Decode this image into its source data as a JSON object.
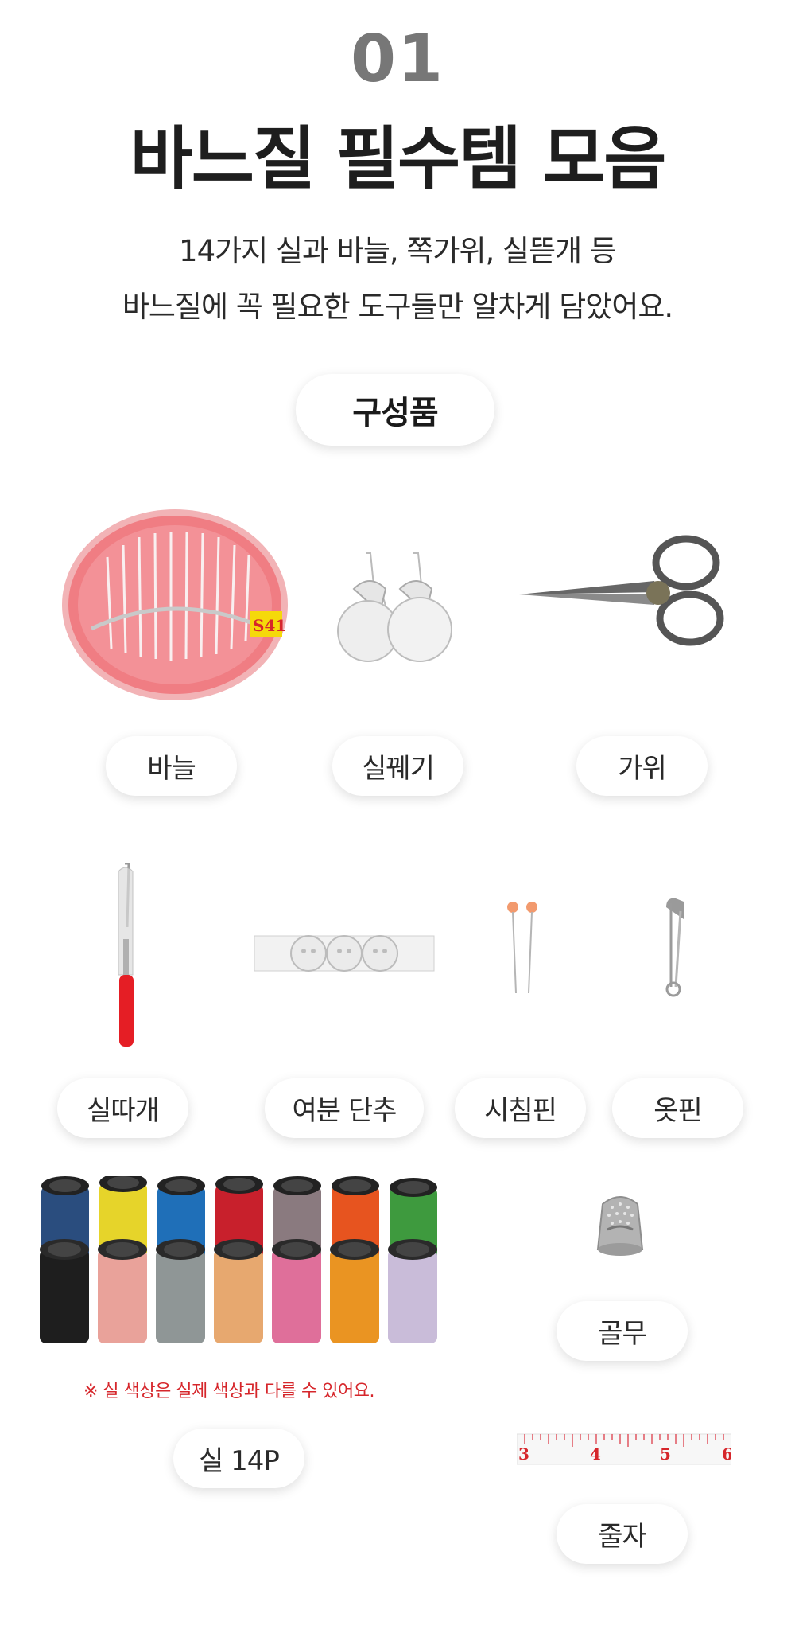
{
  "header": {
    "step_number": "01",
    "title": "바느질 필수템 모음",
    "description_line1": "14가지 실과 바늘, 쪽가위, 실뜯개 등",
    "description_line2": "바느질에 꼭 필요한 도구들만 알차게 담았어요."
  },
  "components_label": "구성품",
  "items": {
    "needle": "바늘",
    "threader": "실꿰기",
    "scissors": "가위",
    "seam_ripper": "실따개",
    "spare_buttons": "여분 단추",
    "sewing_pin": "시침핀",
    "safety_pin": "옷핀",
    "thread": "실 14P",
    "thimble": "골무",
    "tape_measure": "줄자"
  },
  "thread_note": "※ 실 색상은 실제 색상과 다를 수 있어요.",
  "needle_case_label": "S41",
  "tape_numbers": [
    "3",
    "4",
    "5",
    "6"
  ],
  "colors": {
    "accent_red": "#d6262b",
    "step_gray": "#777777"
  }
}
